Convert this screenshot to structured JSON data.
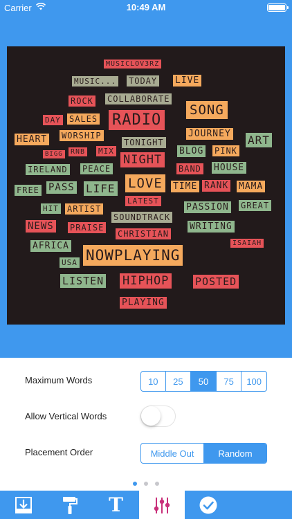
{
  "status_bar": {
    "carrier": "Carrier",
    "time": "10:49 AM"
  },
  "word_cloud": {
    "words": [
      {
        "text": "MUSICLOV3RZ",
        "color": "red"
      },
      {
        "text": "MUSIC...",
        "color": "grey"
      },
      {
        "text": "TODAY",
        "color": "grey"
      },
      {
        "text": "LIVE",
        "color": "orange"
      },
      {
        "text": "ROCK",
        "color": "red"
      },
      {
        "text": "COLLABORATE",
        "color": "grey"
      },
      {
        "text": "SONG",
        "color": "orange"
      },
      {
        "text": "DAY",
        "color": "red"
      },
      {
        "text": "SALES",
        "color": "orange"
      },
      {
        "text": "RADIO",
        "color": "red"
      },
      {
        "text": "WORSHIP",
        "color": "orange"
      },
      {
        "text": "JOURNEY",
        "color": "orange"
      },
      {
        "text": "HEART",
        "color": "orange"
      },
      {
        "text": "TONIGHT",
        "color": "grey"
      },
      {
        "text": "BLOG",
        "color": "green"
      },
      {
        "text": "PINK",
        "color": "orange"
      },
      {
        "text": "ART",
        "color": "green"
      },
      {
        "text": "BIGG",
        "color": "red"
      },
      {
        "text": "RNB",
        "color": "red"
      },
      {
        "text": "MIX",
        "color": "red"
      },
      {
        "text": "NIGHT",
        "color": "red"
      },
      {
        "text": "IRELAND",
        "color": "green"
      },
      {
        "text": "PEACE",
        "color": "green"
      },
      {
        "text": "BAND",
        "color": "red"
      },
      {
        "text": "HOUSE",
        "color": "green"
      },
      {
        "text": "FREE",
        "color": "green"
      },
      {
        "text": "PASS",
        "color": "green"
      },
      {
        "text": "LIFE",
        "color": "green"
      },
      {
        "text": "LOVE",
        "color": "orange"
      },
      {
        "text": "TIME",
        "color": "orange"
      },
      {
        "text": "RANK",
        "color": "red"
      },
      {
        "text": "MAMA",
        "color": "orange"
      },
      {
        "text": "LATEST",
        "color": "red"
      },
      {
        "text": "HIT",
        "color": "green"
      },
      {
        "text": "ARTIST",
        "color": "orange"
      },
      {
        "text": "PASSION",
        "color": "green"
      },
      {
        "text": "GREAT",
        "color": "green"
      },
      {
        "text": "SOUNDTRACK",
        "color": "grey"
      },
      {
        "text": "NEWS",
        "color": "red"
      },
      {
        "text": "PRAISE",
        "color": "red"
      },
      {
        "text": "CHRISTIAN",
        "color": "red"
      },
      {
        "text": "WRITING",
        "color": "green"
      },
      {
        "text": "ISAIAH",
        "color": "red"
      },
      {
        "text": "AFRICA",
        "color": "green"
      },
      {
        "text": "NOWPLAYING",
        "color": "orange"
      },
      {
        "text": "USA",
        "color": "green"
      },
      {
        "text": "LISTEN",
        "color": "green"
      },
      {
        "text": "HIPHOP",
        "color": "red"
      },
      {
        "text": "POSTED",
        "color": "red"
      },
      {
        "text": "PLAYING",
        "color": "red"
      }
    ]
  },
  "settings": {
    "max_words": {
      "label": "Maximum Words",
      "options": [
        "10",
        "25",
        "50",
        "75",
        "100"
      ],
      "selected": "50"
    },
    "vertical_words": {
      "label": "Allow Vertical Words",
      "enabled": false
    },
    "placement_order": {
      "label": "Placement Order",
      "options": [
        "Middle Out",
        "Random"
      ],
      "selected": "Random"
    }
  },
  "page_indicator": {
    "pages": 3,
    "current": 1
  },
  "tab_bar": {
    "tabs": [
      {
        "icon": "download-icon",
        "active": false
      },
      {
        "icon": "paint-roller-icon",
        "active": false
      },
      {
        "icon": "text-icon",
        "label": "T",
        "active": false
      },
      {
        "icon": "sliders-icon",
        "active": true
      },
      {
        "icon": "checkmark-icon",
        "active": false
      }
    ]
  },
  "colors": {
    "accent": "#3f98ee",
    "canvas_background": "#221a1b",
    "word_red": "#e65358",
    "word_orange": "#f5a95d",
    "word_green": "#8fb68d",
    "word_grey": "#a8ab92"
  }
}
